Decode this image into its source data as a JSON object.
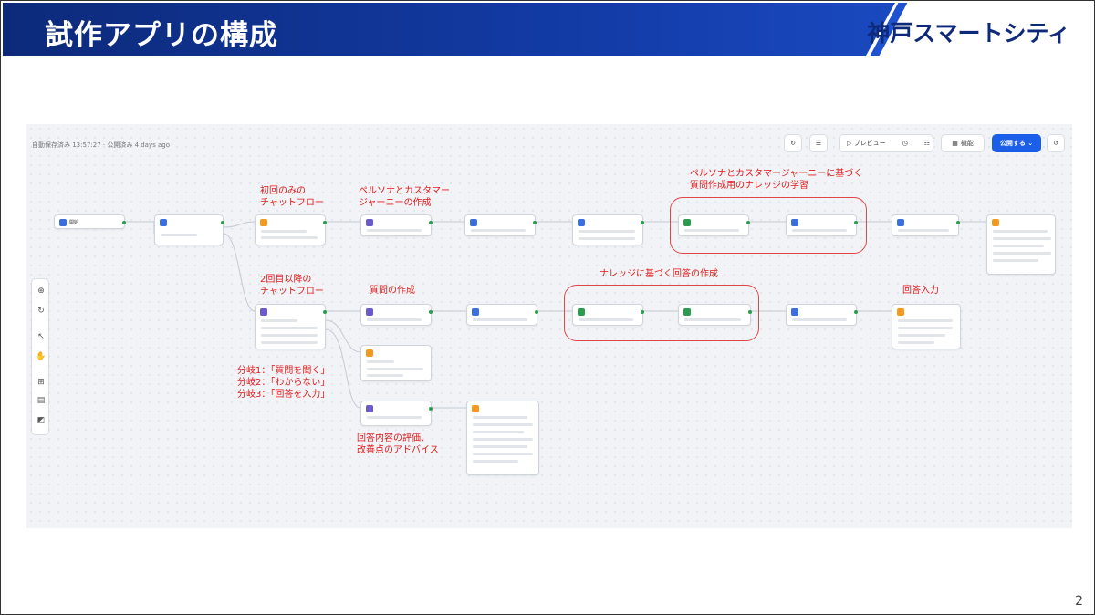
{
  "slide": {
    "title": "試作アプリの構成",
    "brand": "神戸スマートシティ",
    "page_number": "2"
  },
  "canvas": {
    "meta": "自動保存済み 13:57:27 · 公開済み 4 days ago",
    "toolbar": {
      "preview": "▷ プレビュー",
      "features": "機能",
      "publish": "公開する ⌄"
    },
    "icons": [
      "restart-icon",
      "checklist-icon",
      "clock-icon",
      "sliders-icon",
      "settings-icon",
      "history-icon"
    ]
  },
  "nodes": [
    {
      "label": "開始",
      "color": "#3b6fe0"
    },
    {
      "label": "",
      "color": "#3b6fe0"
    },
    {
      "label": "",
      "color": "#f39a1e"
    },
    {
      "label": "",
      "color": "#6a5acd"
    },
    {
      "label": "",
      "color": "#3b6fe0"
    },
    {
      "label": "",
      "color": "#3b6fe0"
    },
    {
      "label": "",
      "color": "#2d9b4f"
    },
    {
      "label": "",
      "color": "#3b6fe0"
    },
    {
      "label": "",
      "color": "#3b6fe0"
    },
    {
      "label": "",
      "color": "#f39a1e"
    },
    {
      "label": "",
      "color": "#6a5acd"
    },
    {
      "label": "",
      "color": "#6a5acd"
    },
    {
      "label": "",
      "color": "#3b6fe0"
    },
    {
      "label": "",
      "color": "#2d9b4f"
    },
    {
      "label": "",
      "color": "#2d9b4f"
    },
    {
      "label": "",
      "color": "#3b6fe0"
    },
    {
      "label": "",
      "color": "#f39a1e"
    },
    {
      "label": "",
      "color": "#f39a1e"
    },
    {
      "label": "",
      "color": "#6a5acd"
    },
    {
      "label": "",
      "color": "#f39a1e"
    }
  ],
  "annotations": {
    "first_flow": "初回のみの\nチャットフロー",
    "persona_create": "ペルソナとカスタマー\nジャーニーの作成",
    "persona_knowledge": "ペルソナとカスタマージャーニーに基づく\n質問作成用のナレッジの学習",
    "second_flow": "2回目以降の\nチャットフロー",
    "question_create": "質問の作成",
    "knowledge_answer": "ナレッジに基づく回答の作成",
    "answer_input": "回答入力",
    "branches": "分岐1：「質問を聞く」\n分岐2：「わからない」\n分岐3：「回答を入力」",
    "evaluation": "回答内容の評価、\n改善点のアドバイス"
  },
  "colors": {
    "header": "#133ca8",
    "annotation": "#e21a1a",
    "primary_button": "#1b5ee8"
  }
}
